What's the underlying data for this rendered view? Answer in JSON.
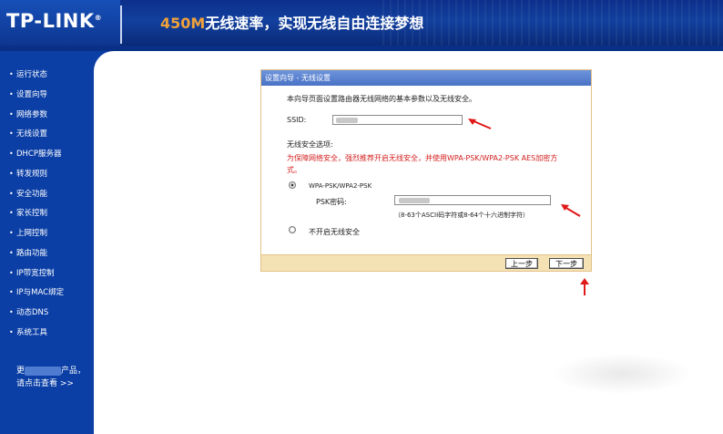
{
  "header": {
    "logo": "TP-LINK",
    "logo_mark": "®",
    "slogan_highlight": "450M",
    "slogan_rest": "无线速率，实现无线自由连接梦想"
  },
  "sidebar": {
    "bullet": "•",
    "items": [
      {
        "label": "运行状态"
      },
      {
        "label": "设置向导"
      },
      {
        "label": "网络参数"
      },
      {
        "label": "无线设置"
      },
      {
        "label": "DHCP服务器"
      },
      {
        "label": "转发规则"
      },
      {
        "label": "安全功能"
      },
      {
        "label": "家长控制"
      },
      {
        "label": "上网控制"
      },
      {
        "label": "路由功能"
      },
      {
        "label": "IP带宽控制"
      },
      {
        "label": "IP与MAC绑定"
      },
      {
        "label": "动态DNS"
      },
      {
        "label": "系统工具"
      }
    ],
    "promo_line1_a": "更",
    "promo_line1_b": "产品，",
    "promo_line2": "请点击查看 >>"
  },
  "dialog": {
    "title": "设置向导 - 无线设置",
    "intro": "本向导页面设置路由器无线网络的基本参数以及无线安全。",
    "ssid_label": "SSID:",
    "security_heading": "无线安全选项:",
    "security_note_line1": "为保障网络安全，强烈推荐开启无线安全，并使用WPA-PSK/WPA2-PSK AES加密方",
    "security_note_line2": "式。",
    "option_wpa": "WPA-PSK/WPA2-PSK",
    "psk_label": "PSK密码:",
    "psk_hint": "（8-63个ASCII码字符或8-64个十六进制字符）",
    "option_none": "不开启无线安全",
    "prev_button": "上一步",
    "next_button": "下一步"
  },
  "colors": {
    "sidebar_bg": "#0b3fa6",
    "header_bg": "#12409e",
    "accent_orange": "#f0a23a",
    "warning_red": "#d42020",
    "arrow_red": "#e01818"
  },
  "icons": [
    "red-arrow-icon"
  ]
}
